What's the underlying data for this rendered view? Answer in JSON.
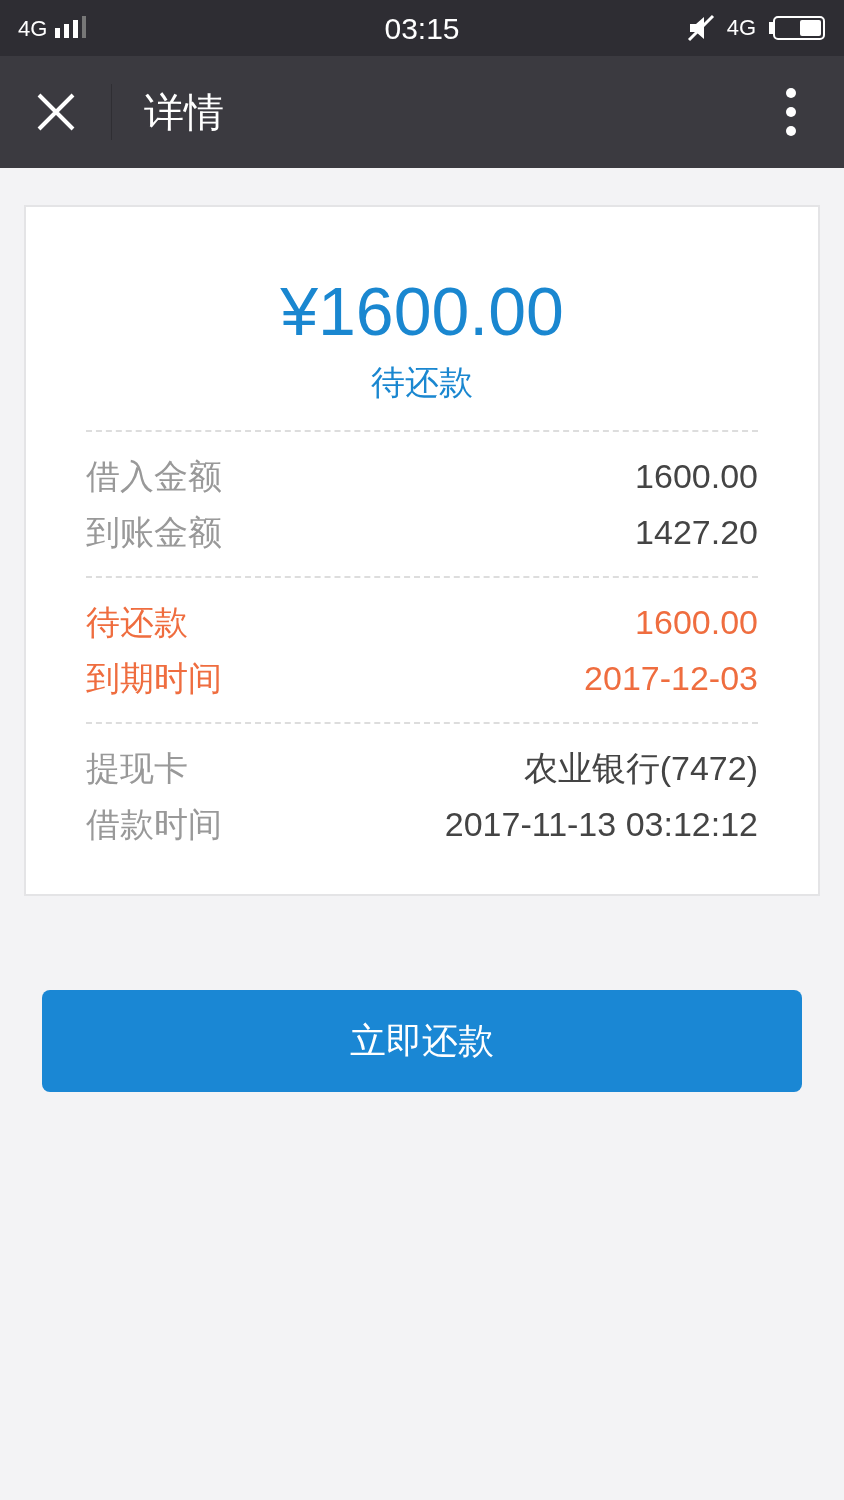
{
  "status_bar": {
    "network_left": "4G",
    "time": "03:15",
    "network_right": "4G"
  },
  "header": {
    "title": "详情"
  },
  "summary": {
    "amount": "¥1600.00",
    "status": "待还款"
  },
  "sections": [
    {
      "rows": [
        {
          "label": "借入金额",
          "value": "1600.00",
          "kind": "normal"
        },
        {
          "label": "到账金额",
          "value": "1427.20",
          "kind": "normal"
        }
      ]
    },
    {
      "rows": [
        {
          "label": "待还款",
          "value": "1600.00",
          "kind": "highlight"
        },
        {
          "label": "到期时间",
          "value": "2017-12-03",
          "kind": "highlight"
        }
      ]
    },
    {
      "rows": [
        {
          "label": "提现卡",
          "value": "农业银行(7472)",
          "kind": "normal"
        },
        {
          "label": "借款时间",
          "value": "2017-11-13 03:12:12",
          "kind": "normal"
        }
      ]
    }
  ],
  "button": {
    "label": "立即还款"
  }
}
